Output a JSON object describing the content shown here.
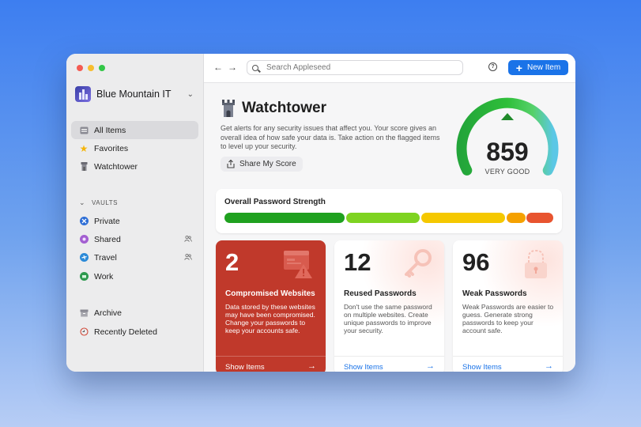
{
  "sidebar": {
    "account_name": "Blue Mountain IT",
    "items": [
      {
        "label": "All Items",
        "icon": "all-items-icon"
      },
      {
        "label": "Favorites",
        "icon": "star-icon"
      },
      {
        "label": "Watchtower",
        "icon": "watchtower-icon"
      }
    ],
    "vaults_header": "VAULTS",
    "vaults": [
      {
        "label": "Private",
        "icon": "private-vault-icon"
      },
      {
        "label": "Shared",
        "icon": "shared-vault-icon"
      },
      {
        "label": "Travel",
        "icon": "travel-vault-icon"
      },
      {
        "label": "Work",
        "icon": "work-vault-icon"
      }
    ],
    "bottom_items": [
      {
        "label": "Archive",
        "icon": "archive-icon"
      },
      {
        "label": "Recently Deleted",
        "icon": "trash-icon"
      }
    ]
  },
  "toolbar": {
    "search_placeholder": "Search Appleseed",
    "new_item_label": "New Item"
  },
  "watchtower": {
    "title": "Watchtower",
    "description": "Get alerts for any security issues that affect you. Your score gives an overall idea of how safe your data is. Take action on the flagged items to level up your security.",
    "share_label": "Share My Score",
    "score": "859",
    "score_label": "VERY GOOD"
  },
  "strength": {
    "label": "Overall Password Strength",
    "colors": [
      "#1fa11f",
      "#7ed321",
      "#f5c800",
      "#f5a100",
      "#e8542f"
    ]
  },
  "cards": [
    {
      "count": "2",
      "title": "Compromised Websites",
      "description": "Data stored by these websites may have been compromised. Change your passwords to keep your accounts safe.",
      "action": "Show Items"
    },
    {
      "count": "12",
      "title": "Reused Passwords",
      "description": "Don't use the same password on multiple websites. Create unique passwords to improve your security.",
      "action": "Show Items"
    },
    {
      "count": "96",
      "title": "Weak Passwords",
      "description": "Weak Passwords are easier to guess. Generate strong passwords to keep your account safe.",
      "action": "Show Items"
    }
  ]
}
